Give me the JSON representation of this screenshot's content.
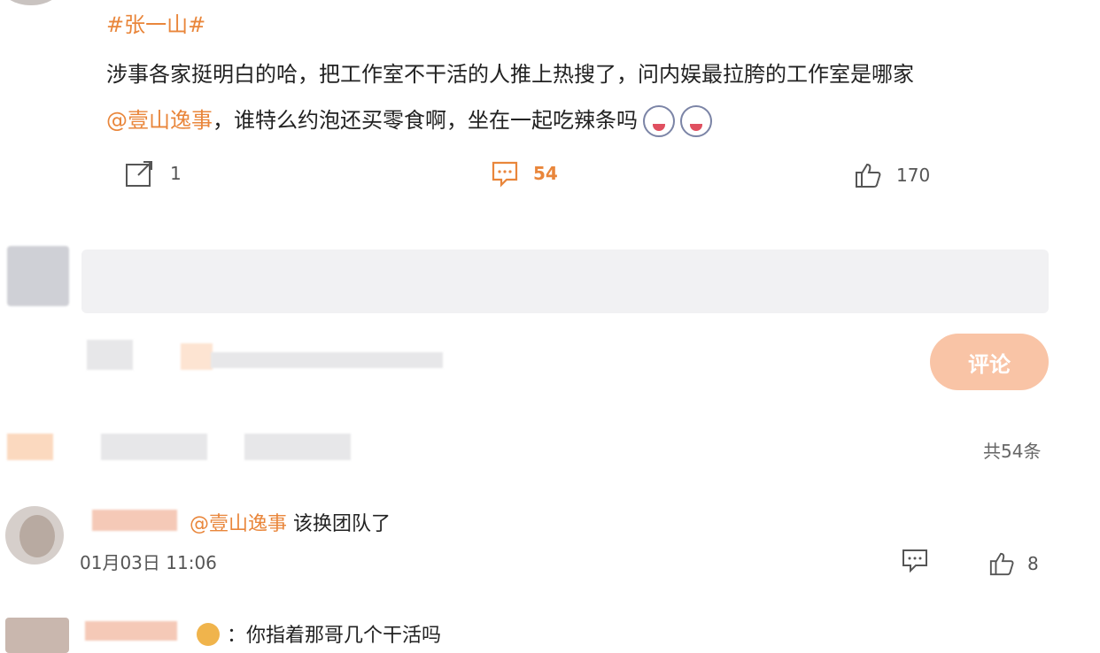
{
  "post": {
    "hashtag": "#张一山#",
    "text_line1": "涉事各家挺明白的哈，把工作室不干活的人推上热搜了，问内娱最拉胯的工作室是哪家",
    "mention": "@壹山逸事",
    "text_line2_rest": "，谁特么约泡还买零食啊，坐在一起吃辣条吗",
    "share_count": "1",
    "comment_count": "54",
    "like_count": "170"
  },
  "composer": {
    "submit_label": "评论"
  },
  "comments": {
    "total_label": "共54条",
    "items": [
      {
        "mention": "@壹山逸事",
        "text": "该换团队了",
        "time": "01月03日 11:06",
        "likes": "8"
      },
      {
        "text": "：你指着那哥几个干活吗"
      }
    ]
  },
  "colors": {
    "accent": "#e9863b",
    "button": "#f9c4a6"
  }
}
